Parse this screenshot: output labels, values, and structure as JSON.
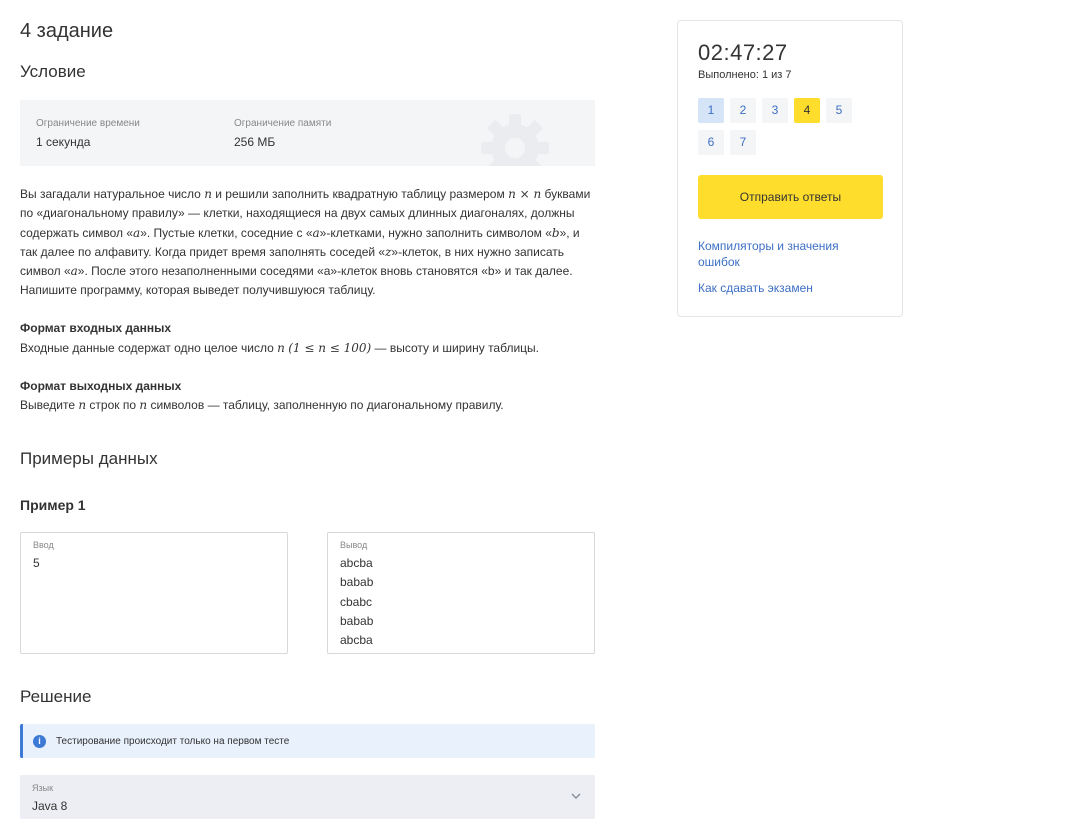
{
  "task": {
    "title": "4 задание",
    "condition_heading": "Условие",
    "limits": {
      "time_label": "Ограничение времени",
      "time_value": "1 секунда",
      "memory_label": "Ограничение памяти",
      "memory_value": "256 МБ"
    },
    "statement": {
      "p1": "Вы загадали натуральное число ",
      "m1": "n",
      "p2": " и решили заполнить квадратную таблицу размером ",
      "m2": "n × n",
      "p3": " буквами по «диагональному правилу» — клетки, находящиеся на двух самых длинных диагоналях, должны содержать символ «",
      "m3": "a",
      "p4": "». Пустые клетки, соседние с «",
      "m4": "a",
      "p5": "»-клетками, нужно заполнить символом «",
      "m5": "b",
      "p6": "», и так далее по алфавиту. Когда придет время заполнять соседей «",
      "m6": "z",
      "p7": "»-клеток, в них нужно записать символ «",
      "m7": "a",
      "p8": "». После этого незаполненными соседями «a»-клеток вновь становятся «b» и так далее. Напишите программу, которая выведет получившуюся таблицу."
    },
    "input_format": {
      "title": "Формат входных данных",
      "p1": "Входные данные содержат одно целое число ",
      "m1": "n",
      "m2": "(1 ≤ n ≤ 100)",
      "p2": " — высоту и ширину таблицы."
    },
    "output_format": {
      "title": "Формат выходных данных",
      "p1": "Выведите ",
      "m1": "n",
      "p2": " строк по ",
      "m2": "n",
      "p3": " символов — таблицу, заполненную по диагональному правилу."
    },
    "examples_heading": "Примеры данных",
    "example": {
      "title": "Пример 1",
      "input_label": "Ввод",
      "input_lines": [
        "5"
      ],
      "output_label": "Вывод",
      "output_lines": [
        "abcba",
        "babab",
        "cbabc",
        "babab",
        "abcba"
      ]
    },
    "solution_heading": "Решение",
    "info_text": "Тестирование происходит только на первом тесте",
    "language": {
      "label": "Язык",
      "value": "Java 8"
    }
  },
  "sidebar": {
    "timer": "02:47:27",
    "progress": "Выполнено: 1 из 7",
    "questions": [
      {
        "label": "1",
        "state": "visited"
      },
      {
        "label": "2",
        "state": "default"
      },
      {
        "label": "3",
        "state": "default"
      },
      {
        "label": "4",
        "state": "active"
      },
      {
        "label": "5",
        "state": "default"
      },
      {
        "label": "6",
        "state": "default"
      },
      {
        "label": "7",
        "state": "default"
      }
    ],
    "submit_label": "Отправить ответы",
    "link_compilers": "Компиляторы и значения ошибок",
    "link_how_to": "Как сдавать экзамен"
  },
  "colors": {
    "accent_yellow": "#ffdd2d",
    "link_blue": "#3d6fc4",
    "info_bg": "#e8f1fc"
  }
}
